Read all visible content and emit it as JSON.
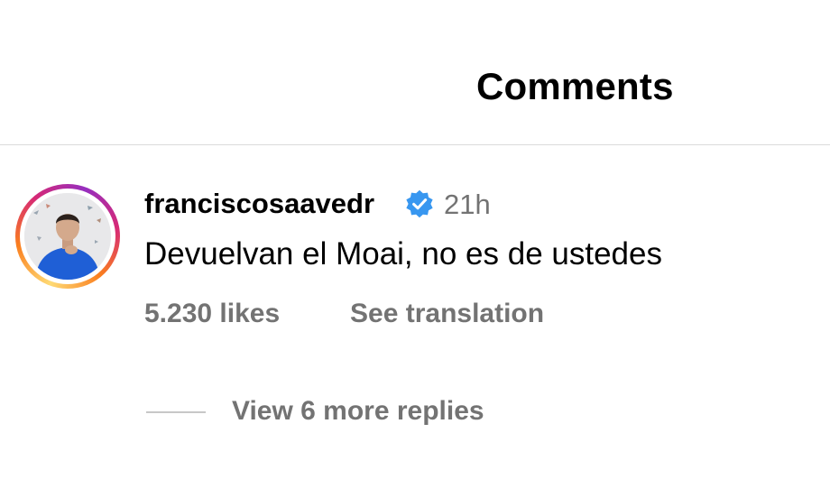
{
  "header": {
    "title": "Comments"
  },
  "comment": {
    "username": "franciscosaavedr",
    "verified": true,
    "timestamp": "21h",
    "text": "Devuelvan el Moai, no es de ustedes",
    "likes": "5.230 likes",
    "translate_label": "See translation",
    "view_replies_label": "View 6 more replies"
  },
  "colors": {
    "verified_badge": "#3897f0",
    "secondary_text": "#737373",
    "divider": "#dbdbdb",
    "avatar_shirt": "#1f5fd6"
  },
  "icons": {
    "verified": "verified-badge-icon",
    "avatar": "user-avatar"
  }
}
